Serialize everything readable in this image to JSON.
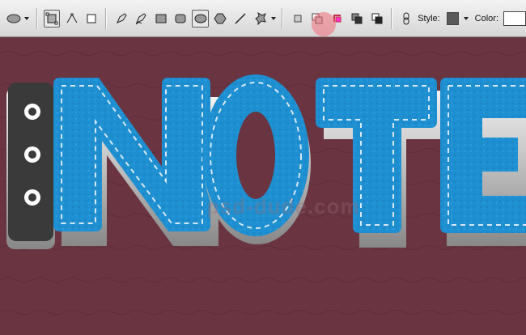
{
  "toolbar": {
    "tools": [
      {
        "name": "ellipse-preset"
      },
      {
        "name": "shape-layers"
      },
      {
        "name": "paths"
      },
      {
        "name": "fill-pixels"
      },
      {
        "name": "pen"
      },
      {
        "name": "freeform-pen"
      },
      {
        "name": "rectangle"
      },
      {
        "name": "rounded-rectangle"
      },
      {
        "name": "ellipse"
      },
      {
        "name": "polygon"
      },
      {
        "name": "line"
      },
      {
        "name": "custom-shape"
      }
    ],
    "combine_modes": [
      "add",
      "subtract",
      "intersect",
      "exclude"
    ],
    "style_label": "Style:",
    "color_label": "Color:",
    "style_color": "#5a5a5a",
    "color_value": "#ffffff",
    "highlight_color": "#f06e78"
  },
  "canvas": {
    "background": "#6a3441",
    "text": "NOTE",
    "leather_color": "#1e8fd0",
    "tab_color": "#3a3a3a",
    "watermark": "psd-dude.com"
  }
}
